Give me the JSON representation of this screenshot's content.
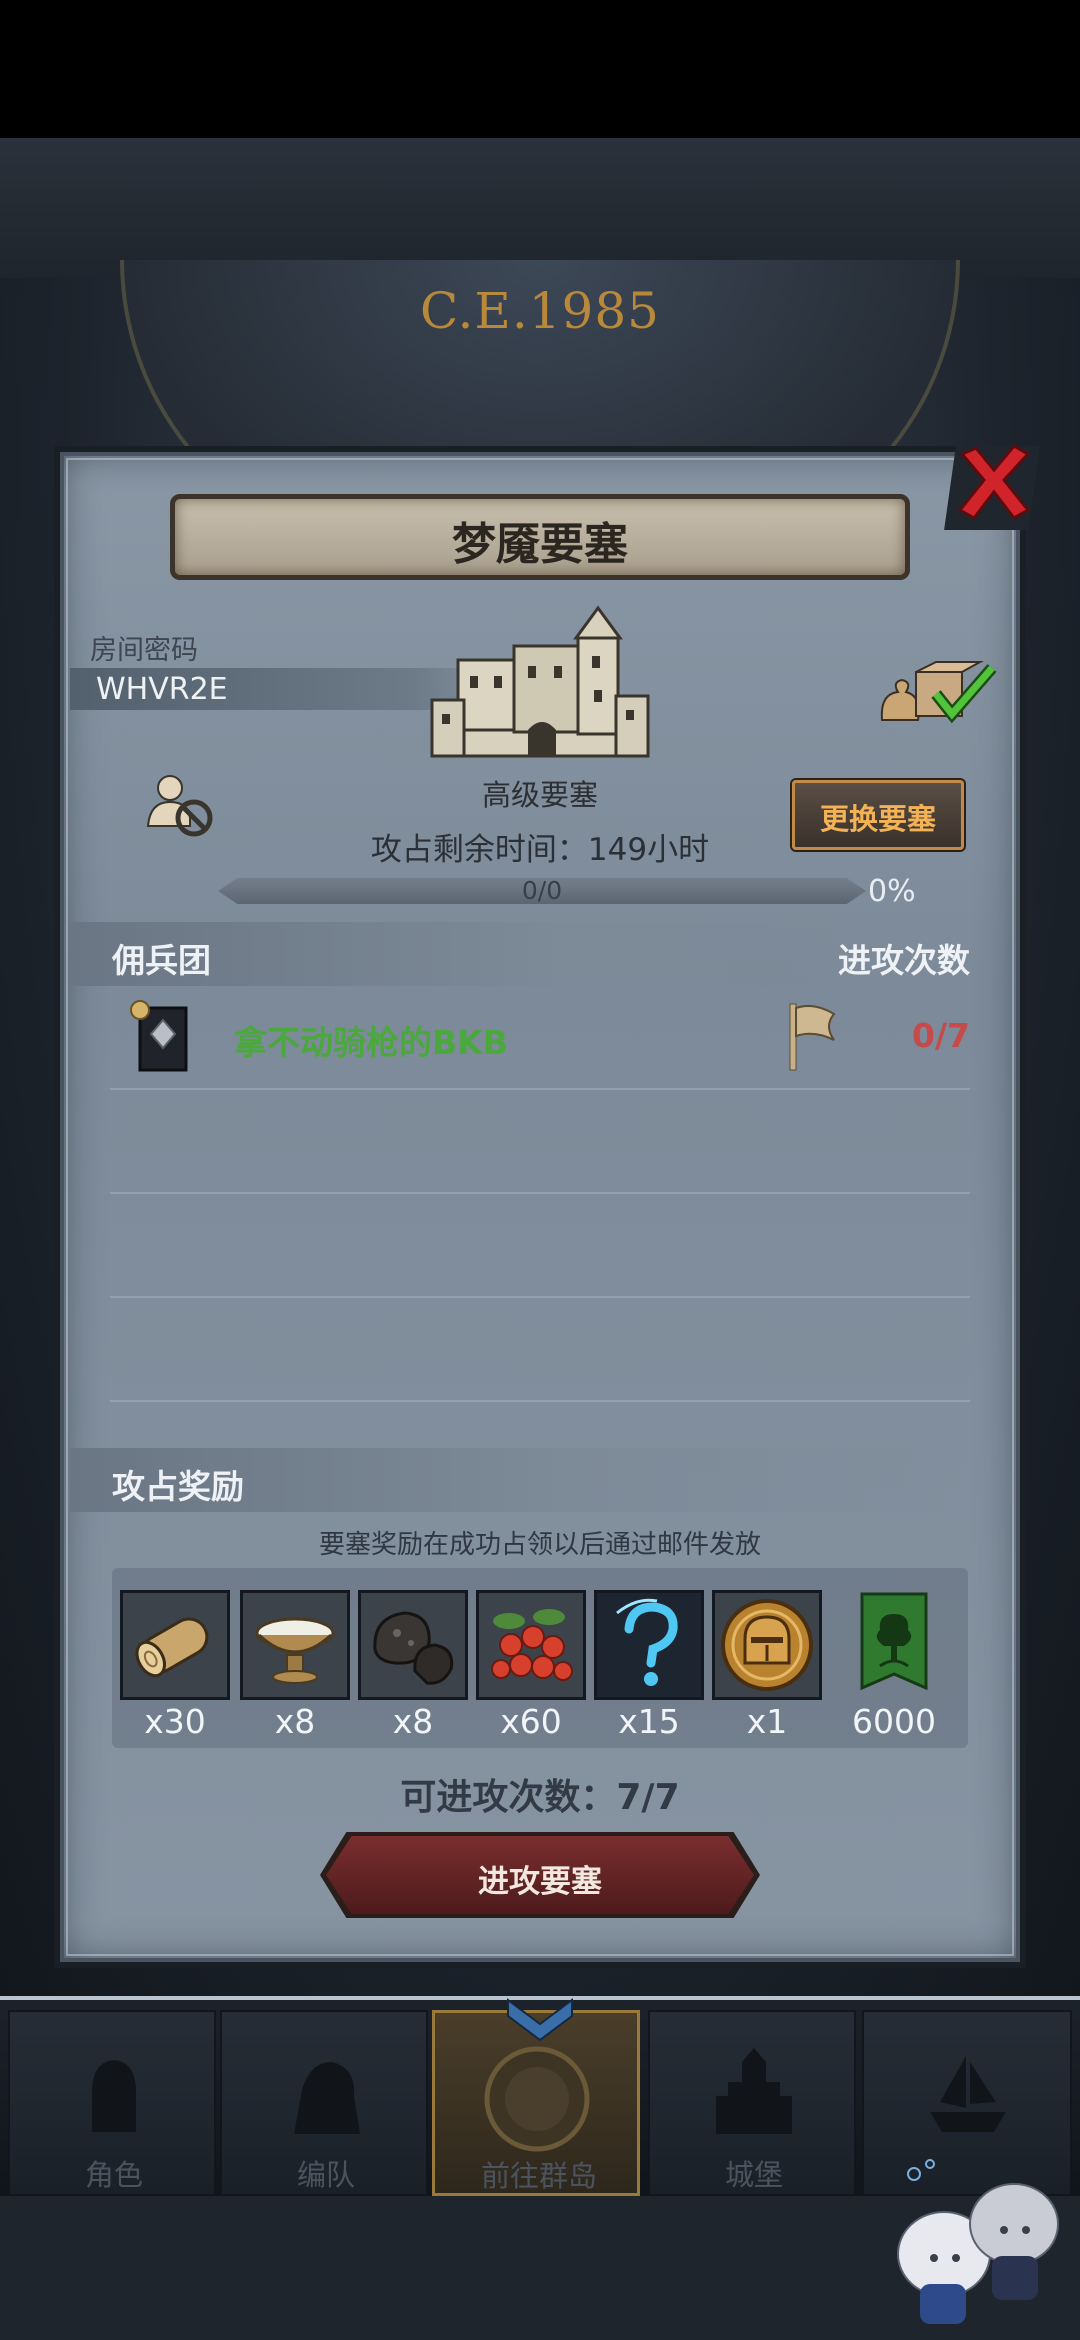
{
  "background": {
    "year": "C.E.1985"
  },
  "dialog": {
    "title": "梦魇要塞",
    "room_label": "房间密码",
    "room_code": "WHVR2E",
    "fortress_level": "高级要塞",
    "change_fortress_label": "更换要塞",
    "remaining_time": "攻占剩余时间：149小时",
    "progress": {
      "text": "0/0",
      "percent": "0%",
      "fraction": 0
    }
  },
  "mercenary": {
    "section_label": "佣兵团",
    "attack_count_label": "进攻次数",
    "members": [
      {
        "name": "拿不动骑枪的BKB",
        "attacks": "0/7"
      }
    ]
  },
  "rewards": {
    "section_label": "攻占奖励",
    "note": "要塞奖励在成功占领以后通过邮件发放",
    "items": [
      {
        "icon": "wood-log-icon",
        "count": "x30"
      },
      {
        "icon": "bowl-icon",
        "count": "x8"
      },
      {
        "icon": "stone-ore-icon",
        "count": "x8"
      },
      {
        "icon": "berries-icon",
        "count": "x60"
      },
      {
        "icon": "mystery-question-icon",
        "count": "x15"
      },
      {
        "icon": "knight-helmet-coin-icon",
        "count": "x1"
      },
      {
        "icon": "guild-banner-icon",
        "count": "6000"
      }
    ]
  },
  "attacks_left": "可进攻次数：7/7",
  "attack_button_label": "进攻要塞",
  "nav": [
    {
      "label": "角色",
      "icon": "knight-icon"
    },
    {
      "label": "编队",
      "icon": "armored-knight-icon"
    },
    {
      "label": "前往群岛",
      "icon": "compass-icon"
    },
    {
      "label": "城堡",
      "icon": "castle-icon"
    },
    {
      "label": "",
      "icon": "ship-icon"
    }
  ],
  "colors": {
    "accent_orange": "#f2b255",
    "merc_green": "#4ba83c",
    "attacks_red": "#c64a4a",
    "close_red": "#d0232a"
  }
}
